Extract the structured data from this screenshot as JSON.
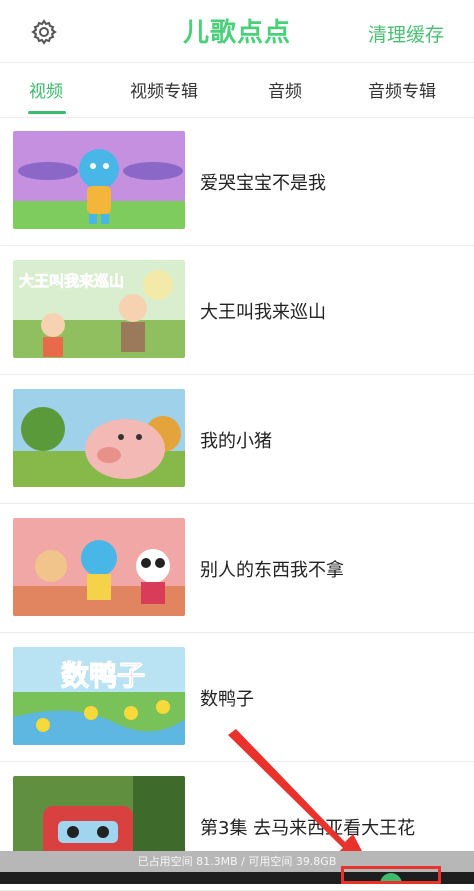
{
  "header": {
    "logo_text": "儿歌点点",
    "clear_cache_label": "清理缓存",
    "settings_icon": "gear-icon"
  },
  "tabs": [
    {
      "label": "视频",
      "active": true
    },
    {
      "label": "视频专辑",
      "active": false
    },
    {
      "label": "音频",
      "active": false
    },
    {
      "label": "音频专辑",
      "active": false
    }
  ],
  "videos": [
    {
      "title": "爱哭宝宝不是我"
    },
    {
      "title": "大王叫我来巡山"
    },
    {
      "title": "我的小猪"
    },
    {
      "title": "别人的东西我不拿"
    },
    {
      "title": "数鸭子"
    },
    {
      "title": "第3集 去马来西亚看大王花"
    }
  ],
  "thumbnail_texts": {
    "video_2": "大王叫我来巡山",
    "video_5": "数鸭子"
  },
  "storage_bar": {
    "text": "已占用空间 81.3MB / 可用空间 39.8GB"
  },
  "colors": {
    "accent": "#3dbb6c",
    "highlight": "#e8322b"
  }
}
